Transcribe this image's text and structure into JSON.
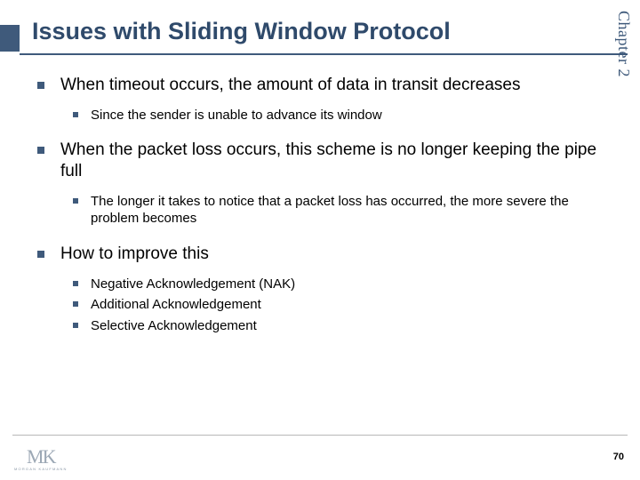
{
  "chapter_label": "Chapter 2",
  "title": "Issues with Sliding Window Protocol",
  "bullets": [
    {
      "text": "When timeout occurs, the amount of data in transit decreases",
      "sub": [
        "Since the sender is unable to advance its window"
      ]
    },
    {
      "text": "When the packet loss occurs, this scheme is no longer keeping the pipe full",
      "sub": [
        "The longer it takes to notice that a packet loss has occurred, the more severe the problem becomes"
      ]
    },
    {
      "text": "How to improve this",
      "sub": [
        "Negative Acknowledgement (NAK)",
        "Additional Acknowledgement",
        "Selective Acknowledgement"
      ]
    }
  ],
  "logo": {
    "main": "MK",
    "sub": "MORGAN KAUFMANN"
  },
  "page_number": "70"
}
